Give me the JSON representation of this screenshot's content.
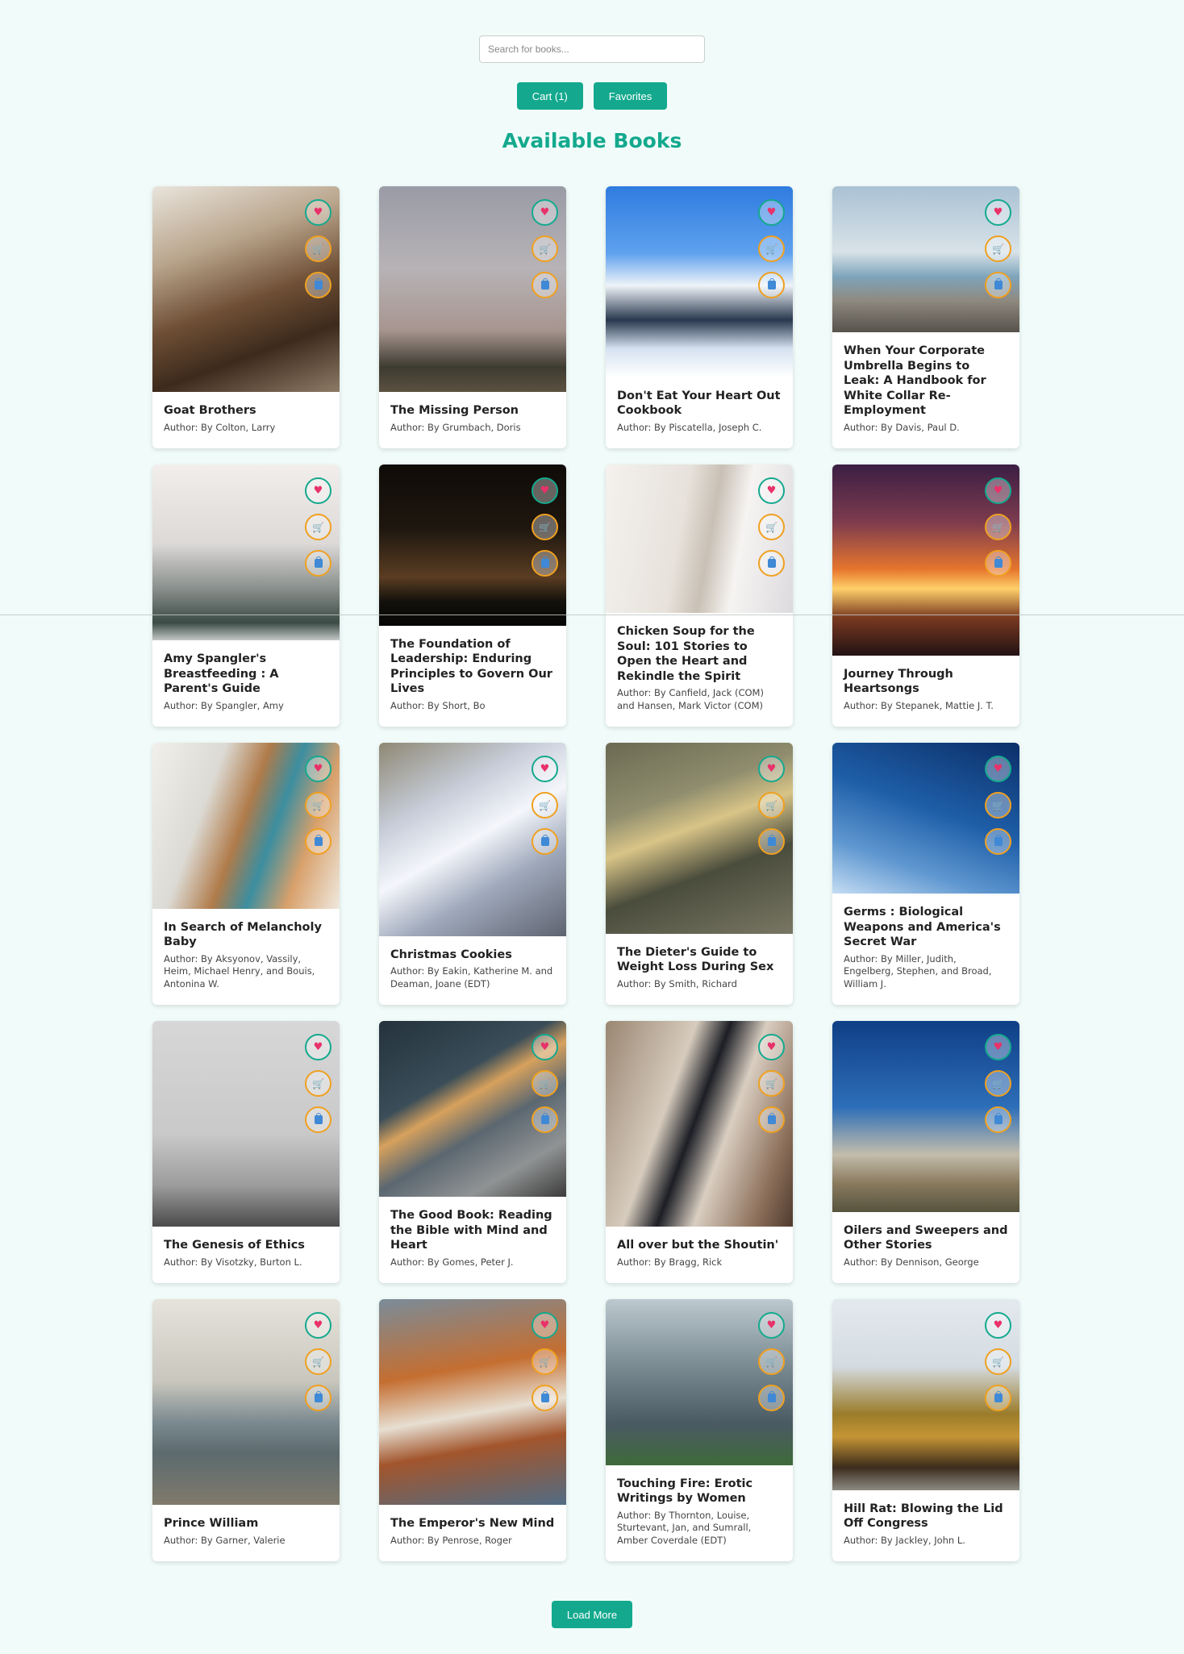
{
  "search": {
    "placeholder": "Search for books..."
  },
  "nav": {
    "cart_label": "Cart (1)",
    "favorites_label": "Favorites"
  },
  "page_title": "Available Books",
  "colors": {
    "accent": "#14a98e",
    "background": "#f1fcfa",
    "heart": "#e8326a",
    "action_ring": "#f0a020"
  },
  "icons": {
    "favorite": "heart-icon",
    "cart": "cart-icon",
    "buy": "shopping-bag-icon"
  },
  "books": [
    {
      "title": "Goat Brothers",
      "author": "Author: By Colton, Larry",
      "image": "coffee beans",
      "img": "linear-gradient(160deg,#e9e4dc 0%,#b9a58c 30%,#6e4f35 55%,#3d2a1c 75%,#8d7a66 100%)"
    },
    {
      "title": "The Missing Person",
      "author": "Author: By Grumbach, Doris",
      "image": "misty horizon",
      "img": "linear-gradient(180deg,#9a9ba6 0%,#b7b3b6 40%,#a7958f 70%,#3e3b31 88%,#5b5140 100%)"
    },
    {
      "title": "Don't Eat Your Heart Out Cookbook",
      "author": "Author: By Piscatella, Joseph C.",
      "image": "snowy mountain",
      "img": "linear-gradient(180deg,#2f7ce0 0%,#5ea1ee 35%,#eef3f8 52%,#29384e 70%,#d6e2f1 85%,#ffffff 100%)"
    },
    {
      "title": "When Your Corporate Umbrella Begins to Leak: A Handbook for White Collar Re-Employment",
      "author": "Author: By Davis, Paul D.",
      "image": "pier over sea",
      "img": "linear-gradient(180deg,#aac2d4 0%,#d8e2e8 45%,#7ea4bb 62%,#8f8a80 78%,#57524b 100%)"
    },
    {
      "title": "Amy Spangler's Breastfeeding : A Parent's Guide",
      "author": "Author: By Spangler, Amy",
      "image": "skyscraper in fog",
      "img": "linear-gradient(180deg,#f1eeec 0%,#dcd9d7 45%,#8b918e 70%,#3c4b45 90%,#c4c8c7 100%)"
    },
    {
      "title": "The Foundation of Leadership: Enduring Principles to Govern Our Lives",
      "author": "Author: By Short, Bo",
      "image": "night sky with trees",
      "img": "linear-gradient(180deg,#0f0b08 0%,#1f170f 40%,#5a3d22 70%,#13110c 85%,#060505 100%)"
    },
    {
      "title": "Chicken Soup for the Soul: 101 Stories to Open the Heart and Rekindle the Spirit",
      "author": "Author: By Canfield, Jack (COM) and Hansen, Mark Victor (COM)",
      "image": "white staircase",
      "img": "linear-gradient(100deg,#f4f1ee 0%,#e7e2db 40%,#c9c0b5 55%,#f6f4f2 70%,#dcdadd 100%)"
    },
    {
      "title": "Journey Through Heartsongs",
      "author": "Author: By Stepanek, Mattie J. T.",
      "image": "sunset over water",
      "img": "linear-gradient(180deg,#3b1e44 0%,#7d3b4e 30%,#e6762d 55%,#ffd06a 65%,#7a3a20 80%,#231214 100%)"
    },
    {
      "title": "In Search of Melancholy Baby",
      "author": "Author: By Aksyonov, Vassily, Heim, Michael Henry, and Bouis, Antonina W.",
      "image": "desk with books",
      "img": "linear-gradient(110deg,#f2f0ec 0%,#dcdad4 30%,#b07b4a 48%,#3c8ea0 62%,#d8a06b 78%,#efe9df 100%)"
    },
    {
      "title": "Christmas Cookies",
      "author": "Author: By Eakin, Katherine M. and Deaman, Joane (EDT)",
      "image": "light beams",
      "img": "linear-gradient(150deg,#8e8874 0%,#c7cdd9 30%,#f4f6fb 50%,#9fa9bb 70%,#5e6370 100%)"
    },
    {
      "title": "The Dieter's Guide to Weight Loss During Sex",
      "author": "Author: By Smith, Richard",
      "image": "autumn leaf",
      "img": "linear-gradient(160deg,#6b6a52 0%,#8f8d6e 30%,#d8c487 45%,#4a4c3c 65%,#797764 100%)"
    },
    {
      "title": "Germs : Biological Weapons and America's Secret War",
      "author": "Author: By Miller, Judith, Engelberg, Stephen, and Broad, William J.",
      "image": "blue sky",
      "img": "linear-gradient(200deg,#0c2f68 0%,#1e5ea8 45%,#5f97d0 75%,#c4dcf3 100%)"
    },
    {
      "title": "The Genesis of Ethics",
      "author": "Author: By Visotzky, Burton L.",
      "image": "foggy forest",
      "img": "linear-gradient(180deg,#d7d7d7 0%,#c9c9c9 55%,#9c9c9c 80%,#4b4b4b 100%)"
    },
    {
      "title": "The Good Book: Reading the Bible with Mind and Heart",
      "author": "Author: By Gomes, Peter J.",
      "image": "sparkler in hand",
      "img": "linear-gradient(150deg,#24323d 0%,#3a4d58 35%,#d7a15d 45%,#5b6770 60%,#909394 80%,#3b3b3a 100%)"
    },
    {
      "title": "All over but the Shoutin'",
      "author": "Author: By Bragg, Rick",
      "image": "jacket on wall",
      "img": "linear-gradient(110deg,#9a8672 0%,#d6cbbd 35%,#1c1e25 48%,#d9cec1 62%,#8c6f5a 85%,#4f3b2e 100%)"
    },
    {
      "title": "Oilers and Sweepers and Other Stories",
      "author": "Author: By Dennison, George",
      "image": "clouds and sky",
      "img": "linear-gradient(180deg,#0f3f86 0%,#2d6eb8 45%,#c3bdab 70%,#8a7a5e 85%,#56533e 100%)"
    },
    {
      "title": "Prince William",
      "author": "Author: By Garner, Valerie",
      "image": "mountain valley",
      "img": "linear-gradient(180deg,#e5e3db 0%,#c9c7bd 40%,#7b8a90 60%,#5c6a6e 75%,#807a6c 100%)"
    },
    {
      "title": "The Emperor's New Mind",
      "author": "Author: By Penrose, Roger",
      "image": "sailing boat",
      "img": "linear-gradient(170deg,#7a8c9a 0%,#c46e31 35%,#e7dfd2 55%,#a2552c 70%,#516c84 100%)"
    },
    {
      "title": "Touching Fire: Erotic Writings by Women",
      "author": "Author: By Thornton, Louise, Sturtevant, Jan, and Sumrall, Amber Coverdale (EDT)",
      "image": "storm clouds",
      "img": "linear-gradient(180deg,#bcc9cf 0%,#7a8b92 40%,#4a5a63 75%,#3f6a3a 100%)"
    },
    {
      "title": "Hill Rat: Blowing the Lid Off Congress",
      "author": "Author: By Jackley, John L.",
      "image": "autumn lake",
      "img": "linear-gradient(180deg,#e3e9ee 0%,#d4dce2 35%,#9b7c2a 60%,#c59535 72%,#3c2c1c 88%,#8d8b83 100%)"
    }
  ],
  "load_more_label": "Load More"
}
